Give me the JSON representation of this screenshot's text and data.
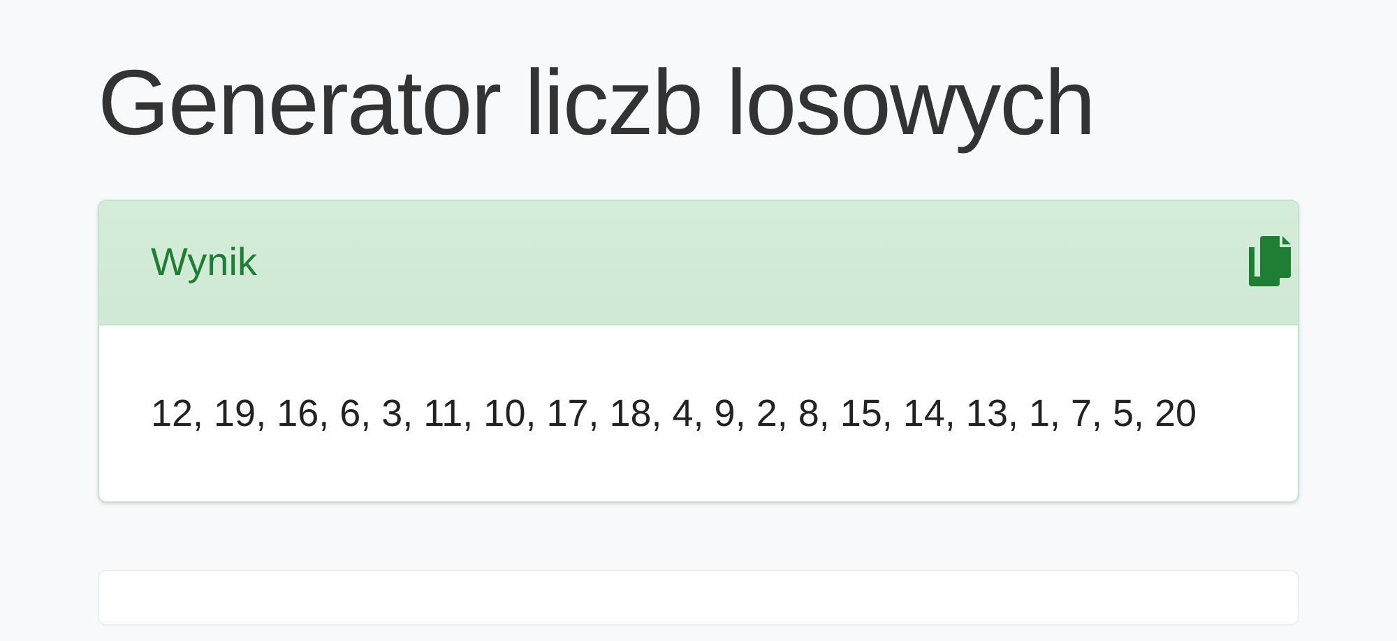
{
  "title": "Generator liczb losowych",
  "result_card": {
    "heading": "Wynik",
    "numbers": "12, 19, 16, 6, 3, 11, 10, 17, 18, 4, 9, 2, 8, 15, 14, 13, 1, 7, 5, 20"
  }
}
